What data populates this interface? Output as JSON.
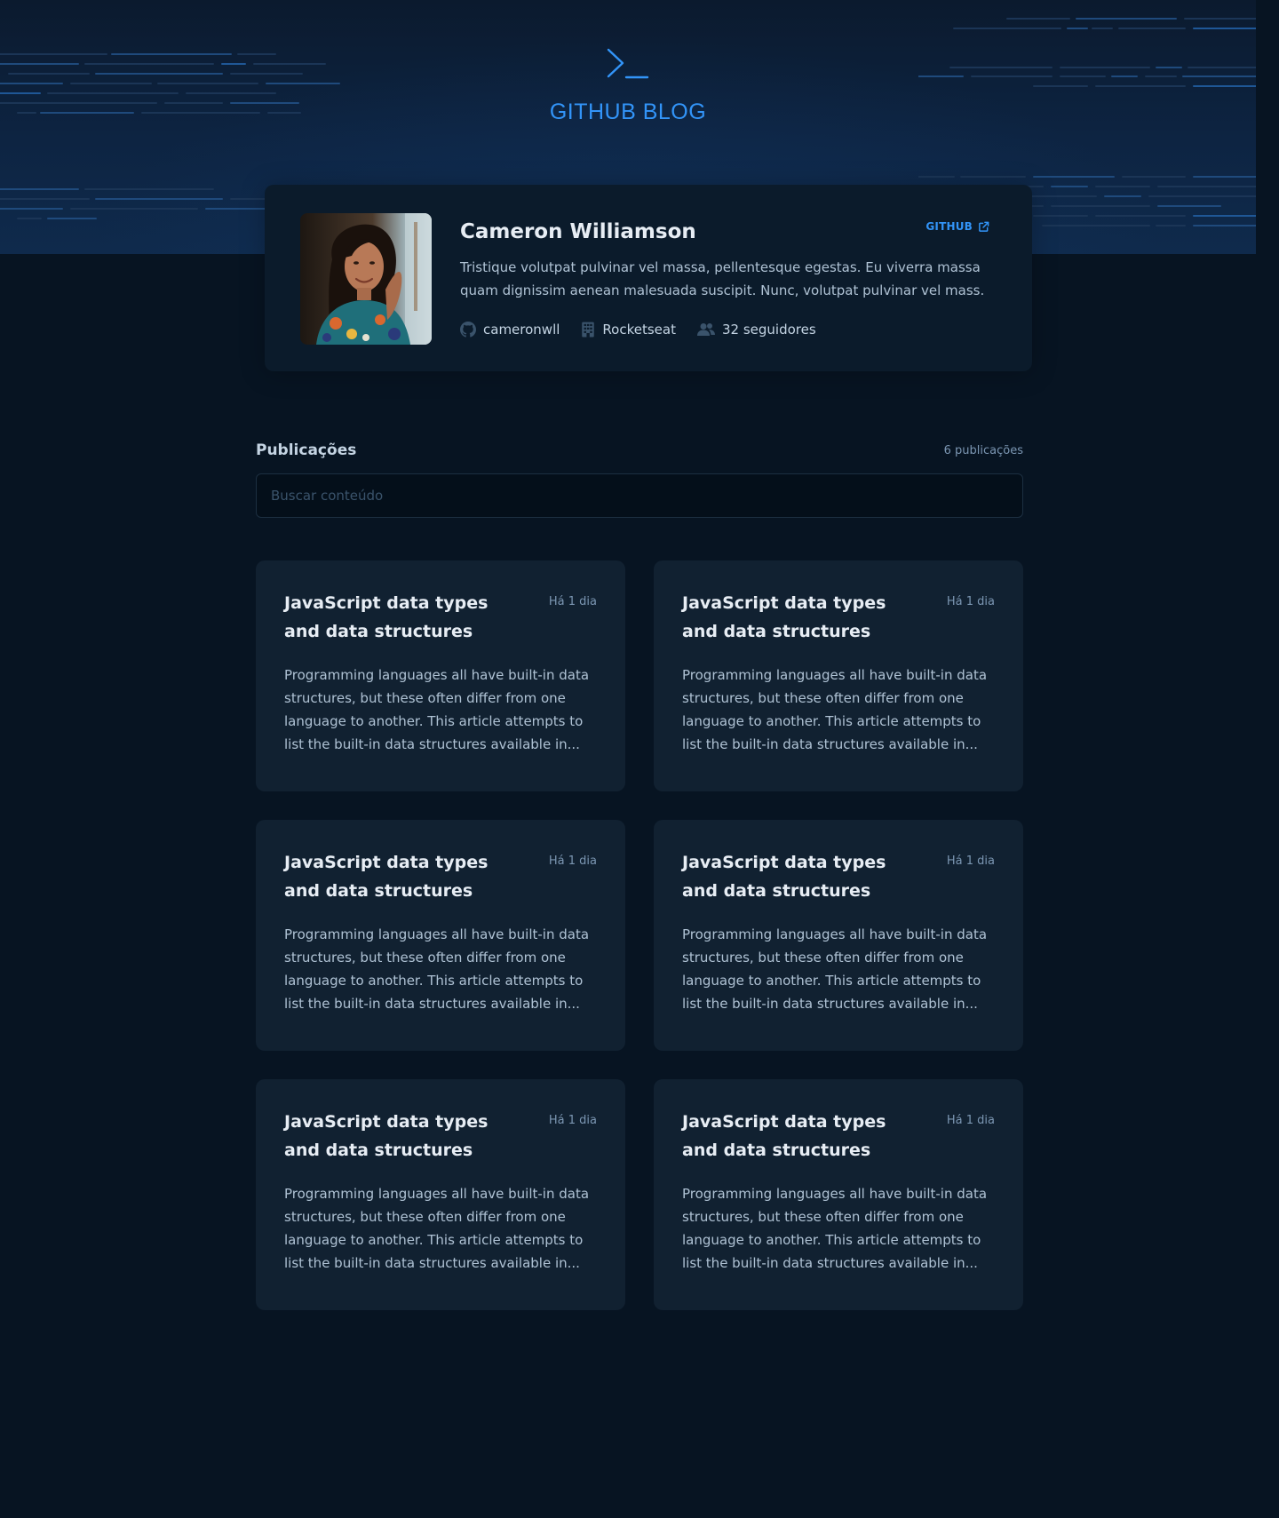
{
  "header": {
    "brand_title": "GITHUB BLOG",
    "brand_icon": "terminal-prompt-icon"
  },
  "profile": {
    "name": "Cameron Williamson",
    "github_link_label": "GITHUB",
    "bio": "Tristique volutpat pulvinar vel massa, pellentesque egestas. Eu viverra massa quam dignissim aenean malesuada suscipit. Nunc, volutpat pulvinar vel mass.",
    "username": "cameronwll",
    "company": "Rocketseat",
    "followers": "32 seguidores"
  },
  "publications": {
    "title": "Publicações",
    "count": "6 publicações",
    "search_placeholder": "Buscar conteúdo",
    "posts": [
      {
        "title": "JavaScript data types and data structures",
        "date": "Há 1 dia",
        "excerpt": "Programming languages all have built-in data structures, but these often differ from one language to another. This article attempts to list the built-in data structures available in..."
      },
      {
        "title": "JavaScript data types and data structures",
        "date": "Há 1 dia",
        "excerpt": "Programming languages all have built-in data structures, but these often differ from one language to another. This article attempts to list the built-in data structures available in..."
      },
      {
        "title": "JavaScript data types and data structures",
        "date": "Há 1 dia",
        "excerpt": "Programming languages all have built-in data structures, but these often differ from one language to another. This article attempts to list the built-in data structures available in..."
      },
      {
        "title": "JavaScript data types and data structures",
        "date": "Há 1 dia",
        "excerpt": "Programming languages all have built-in data structures, but these often differ from one language to another. This article attempts to list the built-in data structures available in..."
      },
      {
        "title": "JavaScript data types and data structures",
        "date": "Há 1 dia",
        "excerpt": "Programming languages all have built-in data structures, but these often differ from one language to another. This article attempts to list the built-in data structures available in..."
      },
      {
        "title": "JavaScript data types and data structures",
        "date": "Há 1 dia",
        "excerpt": "Programming languages all have built-in data structures, but these often differ from one language to another. This article attempts to list the built-in data structures available in..."
      }
    ]
  },
  "colors": {
    "accent": "#3294f8",
    "background": "#071422",
    "card": "#112131",
    "profile_card": "#0b1b2b"
  }
}
